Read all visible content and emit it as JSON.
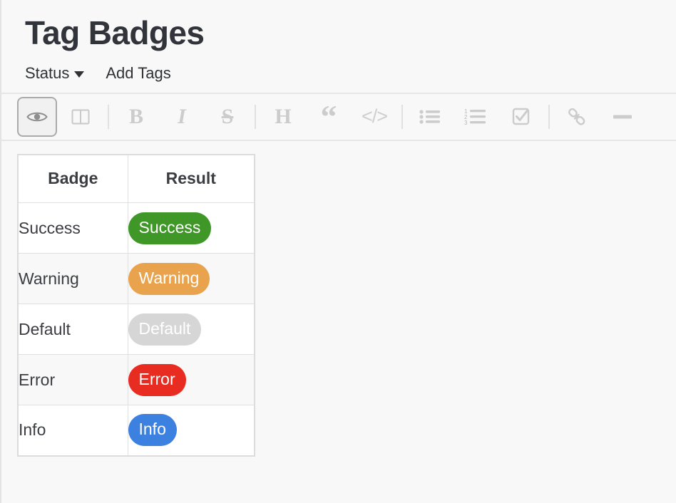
{
  "header": {
    "title": "Tag Badges"
  },
  "menubar": {
    "items": [
      {
        "label": "Status",
        "icon": "chevron-down-icon",
        "has_caret": true
      },
      {
        "label": "Add Tags",
        "has_caret": false
      }
    ]
  },
  "toolbar": {
    "items": [
      {
        "name": "preview-eye-icon",
        "glyph": "",
        "kind": "svg",
        "active": true
      },
      {
        "name": "split-pane-icon",
        "glyph": "",
        "kind": "svg",
        "active": false
      },
      {
        "name": "toolbar-separator-1",
        "kind": "sep"
      },
      {
        "name": "bold-button",
        "glyph": "B",
        "kind": "text"
      },
      {
        "name": "italic-button",
        "glyph": "I",
        "kind": "text"
      },
      {
        "name": "strikethrough-button",
        "glyph": "S",
        "kind": "text"
      },
      {
        "name": "toolbar-separator-2",
        "kind": "sep"
      },
      {
        "name": "heading-button",
        "glyph": "H",
        "kind": "text"
      },
      {
        "name": "blockquote-button",
        "glyph": "“",
        "kind": "text"
      },
      {
        "name": "code-button",
        "glyph": "</>",
        "kind": "text"
      },
      {
        "name": "toolbar-separator-3",
        "kind": "sep"
      },
      {
        "name": "bullet-list-button",
        "glyph": "",
        "kind": "svg"
      },
      {
        "name": "numbered-list-button",
        "glyph": "",
        "kind": "svg"
      },
      {
        "name": "task-list-button",
        "glyph": "",
        "kind": "svg"
      },
      {
        "name": "toolbar-separator-4",
        "kind": "sep"
      },
      {
        "name": "link-button",
        "glyph": "",
        "kind": "svg"
      },
      {
        "name": "horizontal-rule-button",
        "glyph": "",
        "kind": "svg"
      }
    ],
    "labels": {
      "bold": "B",
      "italic": "I",
      "strike": "S",
      "heading": "H",
      "quote": "“",
      "code": "</>"
    }
  },
  "table": {
    "columns": [
      "Badge",
      "Result"
    ],
    "rows": [
      {
        "label": "Success",
        "badge_text": "Success",
        "color": "#3f9728",
        "text_color": "#ffffff"
      },
      {
        "label": "Warning",
        "badge_text": "Warning",
        "color": "#e9a34d",
        "text_color": "#ffffff"
      },
      {
        "label": "Default",
        "badge_text": "Default",
        "color": "#d6d6d6",
        "text_color": "#ffffff"
      },
      {
        "label": "Error",
        "badge_text": "Error",
        "color": "#e92c21",
        "text_color": "#ffffff"
      },
      {
        "label": "Info",
        "badge_text": "Info",
        "color": "#3d81e0",
        "text_color": "#ffffff"
      }
    ]
  },
  "theme": {
    "page_background": "#f8f8f8",
    "table_background": "#ffffff",
    "row_alt_background": "#f8f8f8",
    "border": "#e0e0e0",
    "text": "#3b3d42",
    "toolbar_icon": "#cccccc"
  }
}
